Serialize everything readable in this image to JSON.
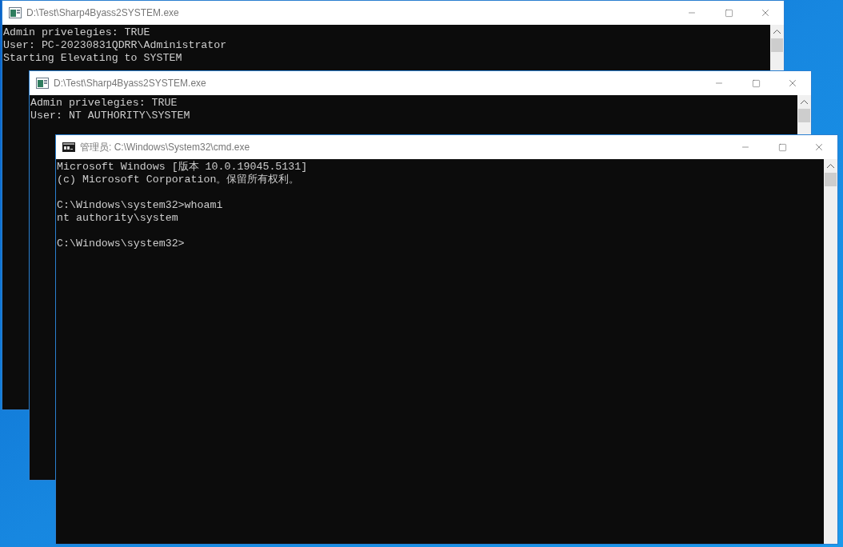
{
  "windows": [
    {
      "title": "D:\\Test\\Sharp4Byass2SYSTEM.exe",
      "kind": "app",
      "blocks": [
        [
          "Admin privelegies: TRUE",
          "User: PC-20230831QDRR\\Administrator",
          "Starting Elevating to SYSTEM"
        ]
      ]
    },
    {
      "title": "D:\\Test\\Sharp4Byass2SYSTEM.exe",
      "kind": "app",
      "blocks": [
        [
          "Admin privelegies: TRUE",
          "User: NT AUTHORITY\\SYSTEM"
        ]
      ]
    },
    {
      "title": "管理员: C:\\Windows\\System32\\cmd.exe",
      "kind": "cmd",
      "blocks": [
        [
          "Microsoft Windows [版本 10.0.19045.5131]",
          "(c) Microsoft Corporation。保留所有权利。"
        ],
        [
          "C:\\Windows\\system32>whoami",
          "nt authority\\system"
        ],
        [
          "C:\\Windows\\system32>"
        ]
      ]
    }
  ]
}
